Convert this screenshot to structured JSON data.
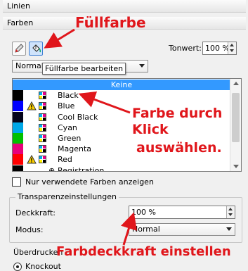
{
  "panel": {
    "tab_lines": "Linien",
    "tab_colors": "Farben",
    "tone_label": "Tonwert:",
    "tone_value": "100 %",
    "blend_mode": "Normal",
    "tooltip": "Füllfarbe bearbeiten"
  },
  "swatches": [
    {
      "name": "Keine",
      "color": "#ffffff",
      "selected": true,
      "warn": false,
      "cmyk": false
    },
    {
      "name": "Black",
      "color": "#000000",
      "selected": false,
      "warn": false,
      "cmyk": true
    },
    {
      "name": "Blue",
      "color": "#0000ff",
      "selected": false,
      "warn": true,
      "cmyk": true
    },
    {
      "name": "Cool Black",
      "color": "#05051a",
      "selected": false,
      "warn": false,
      "cmyk": true
    },
    {
      "name": "Cyan",
      "color": "#00a8e8",
      "selected": false,
      "warn": false,
      "cmyk": true
    },
    {
      "name": "Green",
      "color": "#00c000",
      "selected": false,
      "warn": false,
      "cmyk": true
    },
    {
      "name": "Magenta",
      "color": "#e8007c",
      "selected": false,
      "warn": false,
      "cmyk": true
    },
    {
      "name": "Red",
      "color": "#ff0000",
      "selected": false,
      "warn": true,
      "cmyk": true
    },
    {
      "name": "Registration",
      "color": "#000000",
      "selected": false,
      "warn": false,
      "cmyk": false
    }
  ],
  "options": {
    "only_used_label": "Nur verwendete Farben anzeigen",
    "transparency_title": "Transparenzeinstellungen",
    "opacity_label": "Deckkraft:",
    "opacity_value": "100 %",
    "mode_label": "Modus:",
    "mode_value": "Normal",
    "overprint_title": "Überdrucken",
    "knockout_label": "Knockout"
  },
  "annotations": {
    "fill_color": "Füllfarbe",
    "pick_color_1": "Farbe durch",
    "pick_color_2": "Klick",
    "pick_color_3": "auswählen.",
    "set_opacity": "Farbdeckkraft einstellen",
    "color": "#e0161b"
  }
}
